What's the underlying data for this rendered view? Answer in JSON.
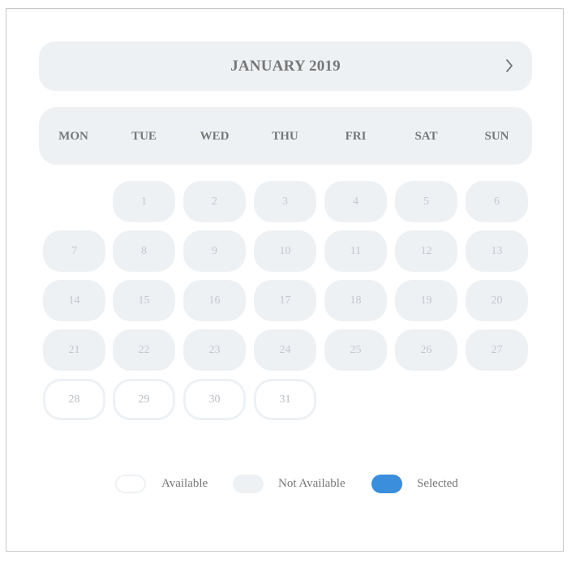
{
  "calendar": {
    "month_title": "JANUARY 2019",
    "next_icon": "chevron-right-icon",
    "weekdays": [
      "MON",
      "TUE",
      "WED",
      "THU",
      "FRI",
      "SAT",
      "SUN"
    ],
    "days": [
      {
        "label": "1",
        "status": "not-available"
      },
      {
        "label": "2",
        "status": "not-available"
      },
      {
        "label": "3",
        "status": "not-available"
      },
      {
        "label": "4",
        "status": "not-available"
      },
      {
        "label": "5",
        "status": "not-available"
      },
      {
        "label": "6",
        "status": "not-available"
      },
      {
        "label": "7",
        "status": "not-available"
      },
      {
        "label": "8",
        "status": "not-available"
      },
      {
        "label": "9",
        "status": "not-available"
      },
      {
        "label": "10",
        "status": "not-available"
      },
      {
        "label": "11",
        "status": "not-available"
      },
      {
        "label": "12",
        "status": "not-available"
      },
      {
        "label": "13",
        "status": "not-available"
      },
      {
        "label": "14",
        "status": "not-available"
      },
      {
        "label": "15",
        "status": "not-available"
      },
      {
        "label": "16",
        "status": "not-available"
      },
      {
        "label": "17",
        "status": "not-available"
      },
      {
        "label": "18",
        "status": "not-available"
      },
      {
        "label": "19",
        "status": "not-available"
      },
      {
        "label": "20",
        "status": "not-available"
      },
      {
        "label": "21",
        "status": "not-available"
      },
      {
        "label": "22",
        "status": "not-available"
      },
      {
        "label": "23",
        "status": "not-available"
      },
      {
        "label": "24",
        "status": "not-available"
      },
      {
        "label": "25",
        "status": "not-available"
      },
      {
        "label": "26",
        "status": "not-available"
      },
      {
        "label": "27",
        "status": "not-available"
      },
      {
        "label": "28",
        "status": "available"
      },
      {
        "label": "29",
        "status": "available"
      },
      {
        "label": "30",
        "status": "available"
      },
      {
        "label": "31",
        "status": "available"
      }
    ]
  },
  "legend": {
    "available": "Available",
    "not_available": "Not Available",
    "selected": "Selected"
  },
  "colors": {
    "not_available_fill": "#eef1f4",
    "available_border": "#eef1f4",
    "selected_fill": "#3a8edb",
    "text": "#777777"
  }
}
